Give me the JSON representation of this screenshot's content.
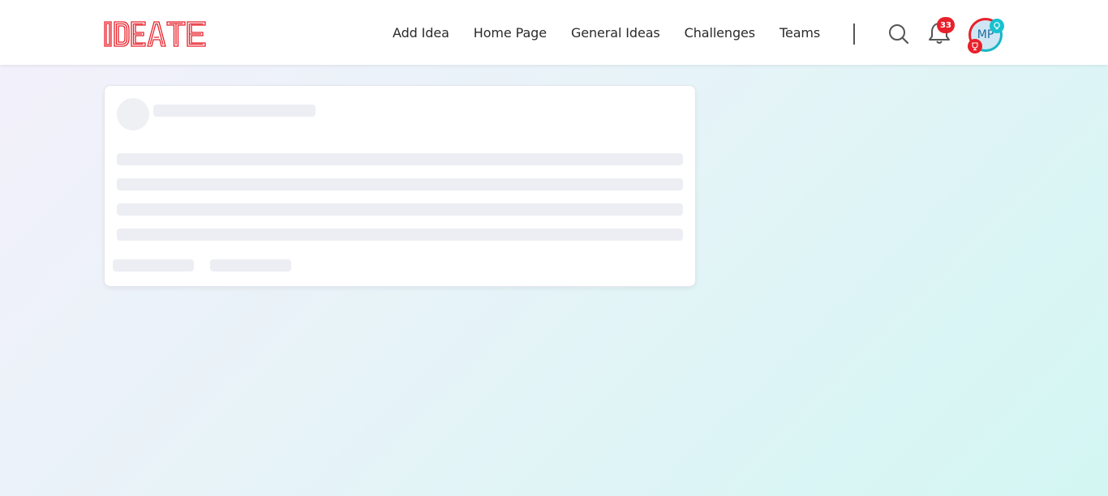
{
  "app": {
    "logo_text": "IDEATE",
    "brand_color": "#e8202a"
  },
  "nav": {
    "items": [
      {
        "label": "Add Idea"
      },
      {
        "label": "Home Page"
      },
      {
        "label": "General Ideas"
      },
      {
        "label": "Challenges"
      },
      {
        "label": "Teams"
      }
    ]
  },
  "toolbar": {
    "search_icon": "search-icon",
    "notification_icon": "bell-icon",
    "notification_count": "33"
  },
  "user": {
    "initials": "MP",
    "top_badge_icon": "lightbulb-icon",
    "bottom_badge_icon": "trophy-icon",
    "accent_colors": [
      "#e8202a",
      "#16b6c4"
    ]
  },
  "main": {
    "loading_card": {
      "state": "loading-skeleton"
    }
  }
}
